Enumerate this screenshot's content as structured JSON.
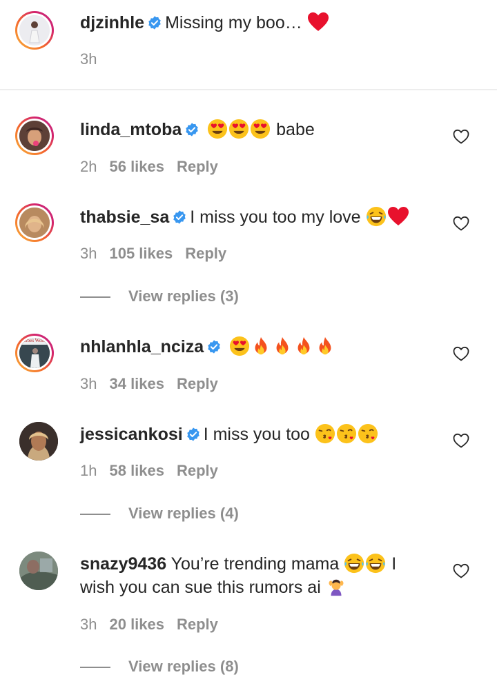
{
  "caption": {
    "username": "djzinhle",
    "text": "Missing my boo…",
    "time": "3h"
  },
  "comments": [
    {
      "username": "linda_mtoba",
      "text": "babe",
      "time": "2h",
      "likes": "56 likes",
      "reply": "Reply"
    },
    {
      "username": "thabsie_sa",
      "text": "I miss you too my love",
      "time": "3h",
      "likes": "105 likes",
      "reply": "Reply",
      "view_replies": "View replies (3)"
    },
    {
      "username": "nhlanhla_nciza",
      "text": "",
      "time": "3h",
      "likes": "34 likes",
      "reply": "Reply",
      "avatar_text": "Forbes Woman"
    },
    {
      "username": "jessicankosi",
      "text": "I miss you too",
      "time": "1h",
      "likes": "58 likes",
      "reply": "Reply",
      "view_replies": "View replies (4)"
    },
    {
      "username": "snazy9436",
      "text": "You’re trending mama",
      "text2": "I wish you can sue this rumors ai",
      "time": "3h",
      "likes": "20 likes",
      "reply": "Reply",
      "view_replies": "View replies (8)"
    }
  ],
  "icons": {
    "verified": "verified-badge-icon",
    "like": "heart-outline-icon"
  },
  "colors": {
    "verified": "#3897f0",
    "meta": "#8e8e8e",
    "heart": "#e8112d"
  }
}
